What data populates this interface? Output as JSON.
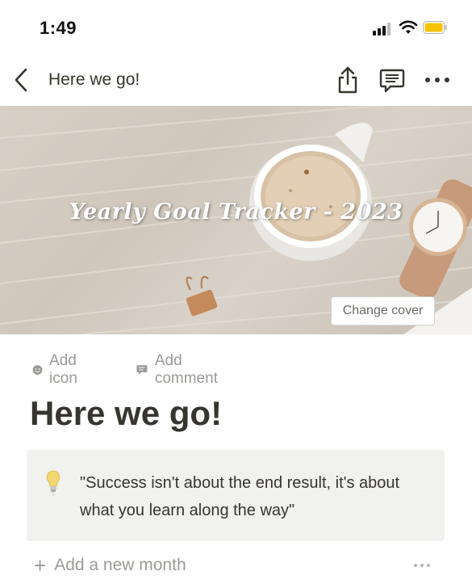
{
  "status_bar": {
    "time": "1:49",
    "icons": [
      "signal-icon",
      "wifi-icon",
      "battery-icon"
    ],
    "battery_color": "#f5c400"
  },
  "nav_bar": {
    "title": "Here we go!",
    "icons": [
      "back-chevron-icon",
      "share-icon",
      "comment-icon",
      "more-icon"
    ]
  },
  "cover": {
    "title_overlay": "Yearly Goal Tracker - 2023",
    "change_cover_label": "Change cover"
  },
  "page_actions": {
    "add_icon_label": "Add icon",
    "add_comment_label": "Add comment"
  },
  "page": {
    "title": "Here we go!"
  },
  "callout": {
    "icon": "lightbulb-icon",
    "text": "\"Success isn't about the end result, it's about what you learn along the way\""
  },
  "bottom": {
    "add_month_label": "Add a new month"
  },
  "colors": {
    "text_primary": "#37352f",
    "text_secondary": "#9b9a97",
    "callout_bg": "#f1f1ef"
  }
}
